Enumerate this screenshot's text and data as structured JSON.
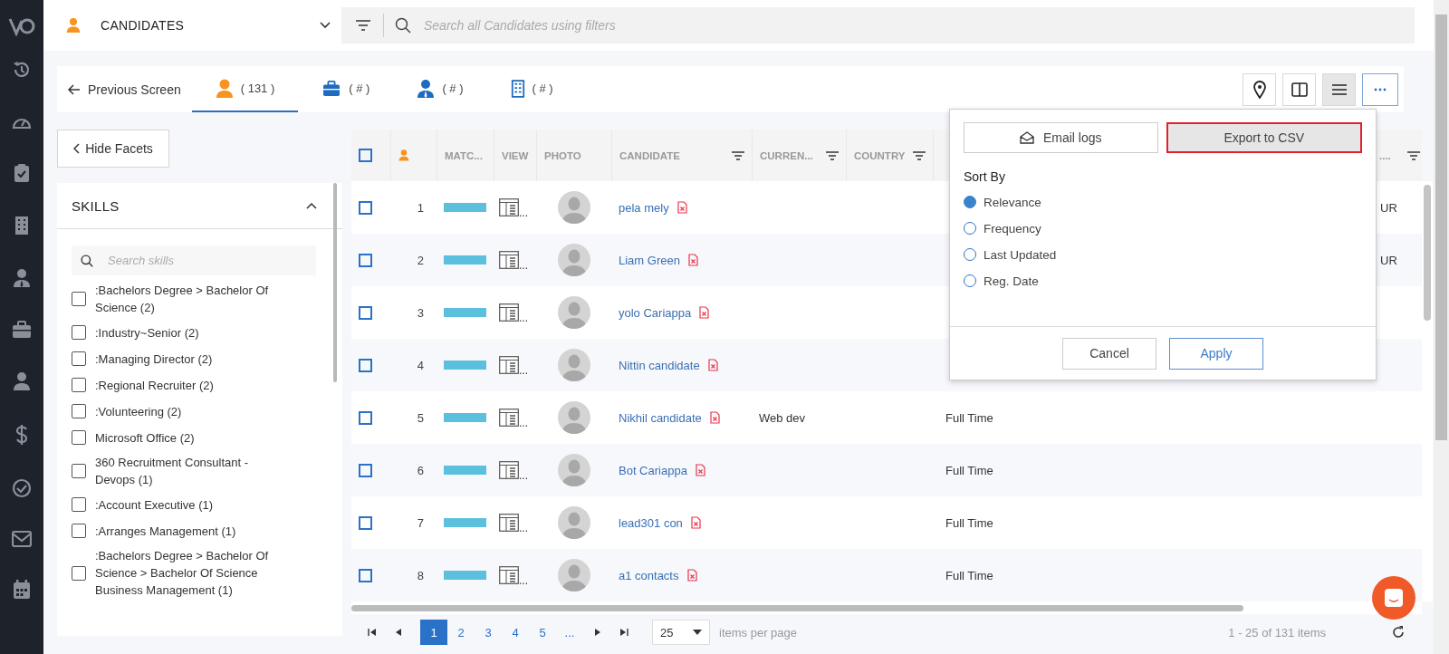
{
  "module": {
    "title": "CANDIDATES"
  },
  "search": {
    "placeholder": "Search all Candidates using filters"
  },
  "back_link": "Previous Screen",
  "tabs": [
    {
      "label": "( 131 )",
      "selected": true
    },
    {
      "label": "( # )",
      "selected": false
    },
    {
      "label": "( # )",
      "selected": false
    },
    {
      "label": "( # )",
      "selected": false
    }
  ],
  "view_buttons": [
    {
      "selected": false
    },
    {
      "selected": false
    },
    {
      "selected": true
    },
    {
      "selected": false
    }
  ],
  "hide_facets": "Hide Facets",
  "facets": {
    "title": "SKILLS",
    "expanded": true,
    "search_placeholder": "Search skills",
    "items": [
      {
        "label": ":Bachelors Degree > Bachelor Of Science (2)",
        "checked": false
      },
      {
        "label": ":Industry~Senior (2)",
        "checked": false
      },
      {
        "label": ":Managing Director (2)",
        "checked": false
      },
      {
        "label": ":Regional Recruiter (2)",
        "checked": false
      },
      {
        "label": ":Volunteering (2)",
        "checked": false
      },
      {
        "label": "Microsoft Office (2)",
        "checked": false
      },
      {
        "label": "360 Recruitment Consultant - Devops (1)",
        "checked": false
      },
      {
        "label": ":Account Executive (1)",
        "checked": false
      },
      {
        "label": ":Arranges Management (1)",
        "checked": false
      },
      {
        "label": ":Bachelors Degree > Bachelor Of Science > Bachelor Of Science Business Management (1)",
        "checked": false
      }
    ]
  },
  "table": {
    "all_checked": false,
    "columns": [
      {
        "label": "MATC..."
      },
      {
        "label": "VIEW"
      },
      {
        "label": "PHOTO"
      },
      {
        "label": "CANDIDATE",
        "filter": true
      },
      {
        "label": "CURREN...",
        "filter": true
      },
      {
        "label": "COUNTRY",
        "filter": true
      },
      {
        "label": "....",
        "filter": true
      }
    ],
    "rows": [
      {
        "checked": false,
        "index": "1",
        "view": "...",
        "name": "pela mely",
        "column_10": "UR"
      },
      {
        "checked": false,
        "index": "2",
        "view": "...",
        "name": "Liam Green",
        "column_10": "UR"
      },
      {
        "checked": false,
        "index": "3",
        "view": "...",
        "name": "yolo Cariappa"
      },
      {
        "checked": false,
        "index": "4",
        "view": "...",
        "name": "Nittin candidate"
      },
      {
        "checked": false,
        "index": "5",
        "view": "...",
        "name": "Nikhil candidate",
        "current": "Web dev",
        "column_9": "Full Time"
      },
      {
        "checked": false,
        "index": "6",
        "view": "...",
        "name": "Bot Cariappa",
        "column_9": "Full Time"
      },
      {
        "checked": false,
        "index": "7",
        "view": "...",
        "name": "lead301 con",
        "column_9": "Full Time"
      },
      {
        "checked": false,
        "index": "8",
        "view": "...",
        "name": "a1 contacts",
        "column_9": "Full Time"
      }
    ]
  },
  "popup": {
    "actions": [
      {
        "label": "Email logs",
        "focused": false
      },
      {
        "label": "Export to CSV",
        "focused": true
      }
    ],
    "sort_title": "Sort By",
    "sort_options": [
      {
        "label": "Relevance",
        "selected": true
      },
      {
        "label": "Frequency",
        "selected": false
      },
      {
        "label": "Last Updated",
        "selected": false
      },
      {
        "label": "Reg. Date",
        "selected": false
      }
    ],
    "buttons": [
      {
        "label": "Cancel",
        "kind": "secondary"
      },
      {
        "label": "Apply",
        "kind": "primary"
      }
    ]
  },
  "pagination": {
    "pages": [
      {
        "label": "1",
        "selected": true
      },
      {
        "label": "2",
        "selected": false
      },
      {
        "label": "3",
        "selected": false
      },
      {
        "label": "4",
        "selected": false
      },
      {
        "label": "5",
        "selected": false
      }
    ],
    "more": "...",
    "page_size": "25",
    "page_size_label": "items per page",
    "summary": "1 - 25 of 131 items"
  }
}
